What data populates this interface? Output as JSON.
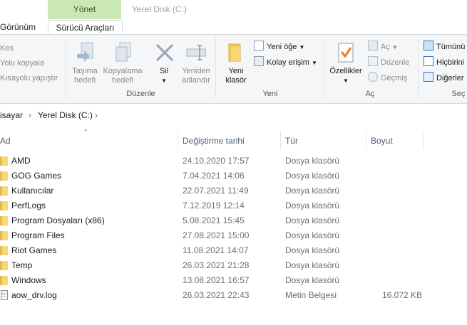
{
  "window": {
    "context_tab": "Yönet",
    "title": "Yerel Disk (C:)"
  },
  "tabs": {
    "view": "Görünüm",
    "drive_tools": "Sürücü Araçları"
  },
  "ribbon": {
    "clipboard": {
      "cut": "Kes",
      "copy_path": "Yolu kopyala",
      "paste_shortcut": "Kısayolu yapıştır"
    },
    "organize": {
      "label": "Düzenle",
      "move_to_1": "Taşıma",
      "move_to_2": "hedefi",
      "copy_to_1": "Kopyalama",
      "copy_to_2": "hedefi",
      "delete": "Sil",
      "rename_1": "Yeniden",
      "rename_2": "adlandır"
    },
    "new": {
      "label": "Yeni",
      "new_folder_1": "Yeni",
      "new_folder_2": "klasör",
      "new_item": "Yeni öğe",
      "easy_access": "Kolay erişim"
    },
    "open": {
      "label": "Aç",
      "properties": "Özellikler",
      "open": "Aç",
      "edit": "Düzenle",
      "history": "Geçmiş"
    },
    "select": {
      "label": "Seç",
      "select_all": "Tümünü",
      "select_none": "Hiçbirini",
      "invert": "Diğerler"
    }
  },
  "breadcrumb": {
    "part1": "isayar",
    "sep": "›",
    "part2": "Yerel Disk (C:)",
    "sep2": "›"
  },
  "columns": {
    "name": "Ad",
    "modified": "Değiştirme tarihi",
    "type": "Tür",
    "size": "Boyut"
  },
  "files": [
    {
      "name": "AMD",
      "modified": "24.10.2020 17:57",
      "type": "Dosya klasörü",
      "size": "",
      "kind": "folder"
    },
    {
      "name": "GOG Games",
      "modified": "7.04.2021 14:06",
      "type": "Dosya klasörü",
      "size": "",
      "kind": "folder"
    },
    {
      "name": "Kullanıcılar",
      "modified": "22.07.2021 11:49",
      "type": "Dosya klasörü",
      "size": "",
      "kind": "folder"
    },
    {
      "name": "PerfLogs",
      "modified": "7.12.2019 12:14",
      "type": "Dosya klasörü",
      "size": "",
      "kind": "folder"
    },
    {
      "name": "Program Dosyaları (x86)",
      "modified": "5.08.2021 15:45",
      "type": "Dosya klasörü",
      "size": "",
      "kind": "folder"
    },
    {
      "name": "Program Files",
      "modified": "27.08.2021 15:00",
      "type": "Dosya klasörü",
      "size": "",
      "kind": "folder"
    },
    {
      "name": "Riot Games",
      "modified": "11.08.2021 14:07",
      "type": "Dosya klasörü",
      "size": "",
      "kind": "folder"
    },
    {
      "name": "Temp",
      "modified": "26.03.2021 21:28",
      "type": "Dosya klasörü",
      "size": "",
      "kind": "folder"
    },
    {
      "name": "Windows",
      "modified": "13.08.2021 16:57",
      "type": "Dosya klasörü",
      "size": "",
      "kind": "folder"
    },
    {
      "name": "aow_drv.log",
      "modified": "26.03.2021 22:43",
      "type": "Metin Belgesi",
      "size": "16.072 KB",
      "kind": "file"
    }
  ],
  "colors": {
    "folder": "#f8d775",
    "manage_tab": "#c9e8b4",
    "header_text": "#4c607a",
    "accent": "#0078d7"
  }
}
